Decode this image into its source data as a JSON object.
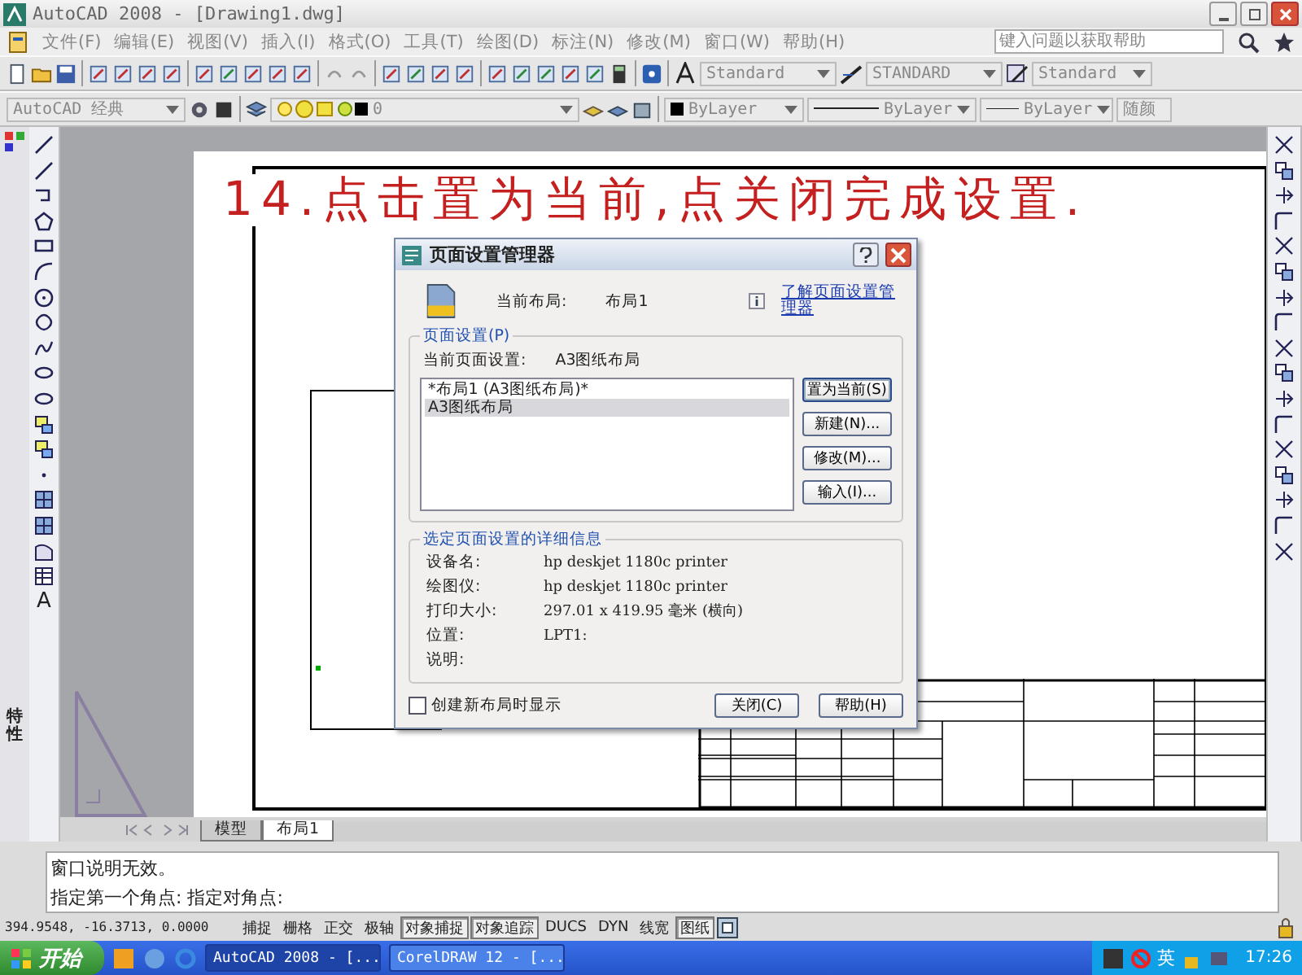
{
  "window": {
    "title": "AutoCAD 2008 - [Drawing1.dwg]"
  },
  "menu": [
    "文件(F)",
    "编辑(E)",
    "视图(V)",
    "插入(I)",
    "格式(O)",
    "工具(T)",
    "绘图(D)",
    "标注(N)",
    "修改(M)",
    "窗口(W)",
    "帮助(H)"
  ],
  "help_search": {
    "placeholder": "键入问题以获取帮助"
  },
  "styles_toolbar": {
    "text_style": "Standard",
    "dim_style": "STANDARD",
    "table_style": "Standard"
  },
  "layers_toolbar": {
    "workspace": "AutoCAD 经典",
    "layer": "0",
    "color_setting": "ByLayer",
    "linetype": "ByLayer",
    "lineweight": "ByLayer",
    "plot_style": "随颜"
  },
  "side_palette": {
    "label": "特性"
  },
  "draw_toolbar": {
    "text_tool": "A"
  },
  "instruction": "14.点击置为当前,点关闭完成设置.",
  "dialog": {
    "title": "页面设置管理器",
    "current_layout_label": "当前布局:",
    "current_layout": "布局1",
    "help_link": "了解页面设置管理器",
    "group_title": "页面设置(P)",
    "current_setup_label": "当前页面设置:",
    "current_setup": "A3图纸布局",
    "setups": [
      {
        "label": "*布局1 (A3图纸布局)*",
        "selected": false
      },
      {
        "label": "A3图纸布局",
        "selected": true
      }
    ],
    "side_buttons": [
      "置为当前(S)",
      "新建(N)...",
      "修改(M)...",
      "输入(I)..."
    ],
    "details_title": "选定页面设置的详细信息",
    "details": [
      {
        "label": "设备名:",
        "value": "hp deskjet 1180c printer"
      },
      {
        "label": "绘图仪:",
        "value": "hp deskjet 1180c printer"
      },
      {
        "label": "打印大小:",
        "value": "297.01 x 419.95 毫米 (横向)"
      },
      {
        "label": "位置:",
        "value": "LPT1:"
      },
      {
        "label": "说明:"
      }
    ],
    "show_on_create": {
      "label": "创建新布局时显示",
      "checked": false
    },
    "footer_buttons": [
      "关闭(C)",
      "帮助(H)"
    ]
  },
  "layout_tabs": [
    {
      "label": "模型",
      "selected": false
    },
    {
      "label": "布局1",
      "selected": true
    }
  ],
  "command_lines": [
    "窗口说明无效。",
    "指定第一个角点: 指定对角点:"
  ],
  "status_bar": {
    "coordinates": "394.9548, -16.3713, 0.0000",
    "toggles": [
      {
        "label": "捕捉",
        "on": false
      },
      {
        "label": "栅格",
        "on": false
      },
      {
        "label": "正交",
        "on": false
      },
      {
        "label": "极轴",
        "on": false
      },
      {
        "label": "对象捕捉",
        "on": true
      },
      {
        "label": "对象追踪",
        "on": true
      },
      {
        "label": "DUCS",
        "on": false
      },
      {
        "label": "DYN",
        "on": false
      },
      {
        "label": "线宽",
        "on": false
      },
      {
        "label": "图纸",
        "on": true
      }
    ]
  },
  "taskbar": {
    "start": "开始",
    "tasks": [
      {
        "label": "AutoCAD 2008 - [...",
        "selected": true
      },
      {
        "label": "CorelDRAW 12 - [...",
        "selected": false
      }
    ],
    "ime": "英",
    "clock": "17:26"
  }
}
